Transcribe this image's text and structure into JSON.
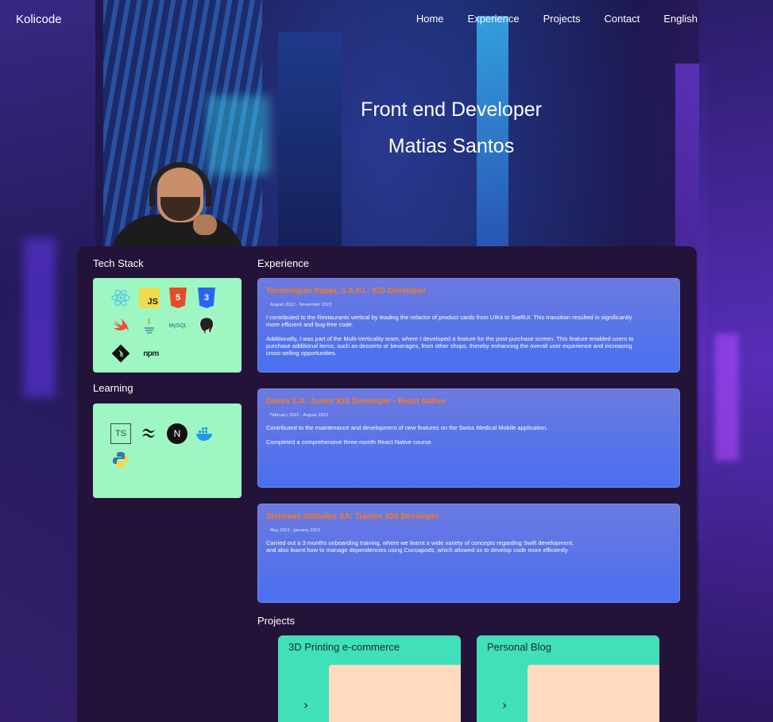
{
  "nav": {
    "brand": "Kolicode",
    "links": [
      "Home",
      "Experience",
      "Projects",
      "Contact",
      "English"
    ]
  },
  "hero": {
    "role": "Front end Developer",
    "name": "Matias Santos"
  },
  "sections": {
    "tech_stack": "Tech Stack",
    "learning": "Learning",
    "experience": "Experience",
    "projects": "Projects"
  },
  "tech_stack_icons": [
    "react-icon",
    "javascript-icon",
    "html5-icon",
    "css3-icon",
    "swift-icon",
    "java-icon",
    "mysql-icon",
    "postgresql-icon",
    "git-icon",
    "npm-icon"
  ],
  "learning_icons": [
    "typescript-icon",
    "tailwind-icon",
    "nextjs-icon",
    "docker-icon",
    "python-icon"
  ],
  "icon_glyphs": {
    "js": "JS",
    "html": "5",
    "css": "3",
    "npm": "npm",
    "ts": "TS",
    "next": "N",
    "mysql": "MySQL"
  },
  "experience": [
    {
      "title": "Tecnologias Rappi, S.A.P.I.: IOS Developer",
      "date": "August 2022 - November 2023",
      "paragraphs": [
        "I contributed to the Restaurants vertical by leading the refactor of product cards from UIKit to SwiftUI. This transition resulted in significantly more efficient and bug-free code.",
        "Additionally, I was part of the Multi-Verticality team, where I developed a feature for the post-purchase screen. This feature enabled users to purchase additional items, such as desserts or beverages, from other shops, thereby enhancing the overall user experience and increasing cross-selling opportunities."
      ]
    },
    {
      "title": "Daeva S.A: Junior IOS Developer - React Native",
      "date": "February 2022 - August 2022",
      "paragraphs": [
        "Contributed to the maintenance and development of new features on the Swiss Medical Mobile application.",
        "Completed a comprehensive three-month React Native course."
      ]
    },
    {
      "title": "Sistemas Globales SA: Trainee IOS Developer",
      "date": "May 2021 - January 2022",
      "paragraphs": [
        "Carried out a 3 months onboarding training, where we learnt a wide variety of concepts regarding Swift development, and also learnt how to manage dependencies using Cocoapods, which allowed us to develop code more efficiently"
      ]
    }
  ],
  "projects": [
    {
      "title": "3D Printing e-commerce"
    },
    {
      "title": "Personal Blog"
    }
  ],
  "colors": {
    "panel": "#241338",
    "icon_box": "#9ef7c2",
    "card": "#4a6ff0",
    "card_title": "#ff7a1a",
    "project_card": "#40e0b8",
    "project_image": "#ffd9c0"
  }
}
